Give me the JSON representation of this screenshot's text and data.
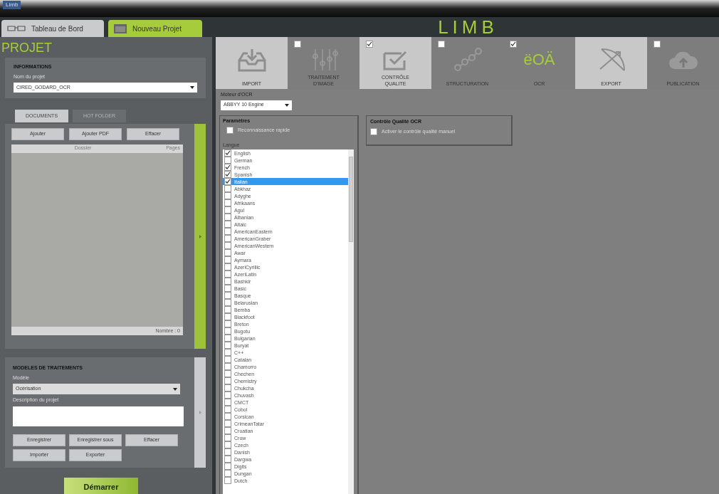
{
  "window": {
    "title": "Limb"
  },
  "nav_tabs": [
    {
      "label": "Tableau de Bord",
      "kind": "glasses",
      "selected": false
    },
    {
      "label": "Nouveau Projet",
      "kind": "folder",
      "selected": true
    }
  ],
  "logo": "LIMB",
  "project": {
    "heading": "PROJET",
    "informations": {
      "title": "INFORMATIONS",
      "name_label": "Nom du projet",
      "name_value": "CIRED_GODARD_OCR"
    },
    "doc_tabs": [
      {
        "label": "DOCUMENTS",
        "selected": true
      },
      {
        "label": "HOT FOLDER",
        "selected": false
      }
    ],
    "documents": {
      "buttons": [
        "Ajouter",
        "Ajouter PDF",
        "Effacer"
      ],
      "columns": [
        "Dossier",
        "Pages"
      ],
      "footer": "Nombre : 0"
    },
    "models": {
      "title": "MODELES DE TRAITEMENTS",
      "model_label": "Modèle",
      "model_value": "Océrisation",
      "description_label": "Description du projet",
      "buttons": [
        "Enregistrer",
        "Enregistrer sous",
        "Effacer",
        "Importer",
        "Exporter"
      ]
    },
    "start_button": "Démarrer"
  },
  "steps": [
    {
      "label": "IMPORT",
      "kind": "import",
      "enabled": true,
      "selected": false
    },
    {
      "label": "TRAITEMENT\nD'IMAGE",
      "kind": "sliders",
      "enabled": false,
      "selected": false,
      "checked": false
    },
    {
      "label": "CONTRÔLE\nQUALITE",
      "kind": "check",
      "enabled": true,
      "selected": false,
      "checked": true
    },
    {
      "label": "STRUCTURATION",
      "kind": "nodes",
      "enabled": false,
      "selected": false,
      "checked": false
    },
    {
      "label": "OCR",
      "kind": "ocr",
      "icon_text": "ëOÄ",
      "enabled": false,
      "selected": true,
      "checked": true
    },
    {
      "label": "EXPORT",
      "kind": "bow",
      "enabled": true,
      "selected": false
    },
    {
      "label": "PUBLICATION",
      "kind": "cloud",
      "enabled": false,
      "selected": false,
      "checked": false
    }
  ],
  "ocr": {
    "engine_label": "Moteur d'OCR",
    "engine_value": "ABBYY 10 Engine",
    "parameters": {
      "title": "Paramètres",
      "fast_label": "Reconnaissance rapide",
      "fast_checked": false,
      "language_label": "Langue",
      "languages": [
        {
          "name": "English",
          "checked": true,
          "selected": false
        },
        {
          "name": "German",
          "checked": false,
          "selected": false
        },
        {
          "name": "French",
          "checked": true,
          "selected": false
        },
        {
          "name": "Spanish",
          "checked": true,
          "selected": false
        },
        {
          "name": "Italian",
          "checked": true,
          "selected": true
        },
        {
          "name": "Abkhaz",
          "checked": false,
          "selected": false
        },
        {
          "name": "Adyghe",
          "checked": false,
          "selected": false
        },
        {
          "name": "Afrikaans",
          "checked": false,
          "selected": false
        },
        {
          "name": "Agul",
          "checked": false,
          "selected": false
        },
        {
          "name": "Albanian",
          "checked": false,
          "selected": false
        },
        {
          "name": "Altaic",
          "checked": false,
          "selected": false
        },
        {
          "name": "AmericanEastern",
          "checked": false,
          "selected": false
        },
        {
          "name": "AmericanGraber",
          "checked": false,
          "selected": false
        },
        {
          "name": "AmericanWestern",
          "checked": false,
          "selected": false
        },
        {
          "name": "Awar",
          "checked": false,
          "selected": false
        },
        {
          "name": "Aymara",
          "checked": false,
          "selected": false
        },
        {
          "name": "AzeriCyrillic",
          "checked": false,
          "selected": false
        },
        {
          "name": "AzeriLatin",
          "checked": false,
          "selected": false
        },
        {
          "name": "Bashkir",
          "checked": false,
          "selected": false
        },
        {
          "name": "Basic",
          "checked": false,
          "selected": false
        },
        {
          "name": "Basque",
          "checked": false,
          "selected": false
        },
        {
          "name": "Belarusian",
          "checked": false,
          "selected": false
        },
        {
          "name": "Bemba",
          "checked": false,
          "selected": false
        },
        {
          "name": "Blackfoot",
          "checked": false,
          "selected": false
        },
        {
          "name": "Breton",
          "checked": false,
          "selected": false
        },
        {
          "name": "Bugotu",
          "checked": false,
          "selected": false
        },
        {
          "name": "Bulgarian",
          "checked": false,
          "selected": false
        },
        {
          "name": "Buryat",
          "checked": false,
          "selected": false
        },
        {
          "name": "C++",
          "checked": false,
          "selected": false
        },
        {
          "name": "Catalan",
          "checked": false,
          "selected": false
        },
        {
          "name": "Chamorro",
          "checked": false,
          "selected": false
        },
        {
          "name": "Chechen",
          "checked": false,
          "selected": false
        },
        {
          "name": "Chemistry",
          "checked": false,
          "selected": false
        },
        {
          "name": "Chukcha",
          "checked": false,
          "selected": false
        },
        {
          "name": "Chuvash",
          "checked": false,
          "selected": false
        },
        {
          "name": "CMCT",
          "checked": false,
          "selected": false
        },
        {
          "name": "Cobol",
          "checked": false,
          "selected": false
        },
        {
          "name": "Corsican",
          "checked": false,
          "selected": false
        },
        {
          "name": "CrimeanTatar",
          "checked": false,
          "selected": false
        },
        {
          "name": "Croatian",
          "checked": false,
          "selected": false
        },
        {
          "name": "Crow",
          "checked": false,
          "selected": false
        },
        {
          "name": "Czech",
          "checked": false,
          "selected": false
        },
        {
          "name": "Danish",
          "checked": false,
          "selected": false
        },
        {
          "name": "Dargwa",
          "checked": false,
          "selected": false
        },
        {
          "name": "Digits",
          "checked": false,
          "selected": false
        },
        {
          "name": "Dungan",
          "checked": false,
          "selected": false
        },
        {
          "name": "Dutch",
          "checked": false,
          "selected": false
        }
      ]
    },
    "quality": {
      "title": "Contrôle Qualité OCR",
      "manual_label": "Activer le contrôle qualité manuel",
      "manual_checked": false
    }
  }
}
